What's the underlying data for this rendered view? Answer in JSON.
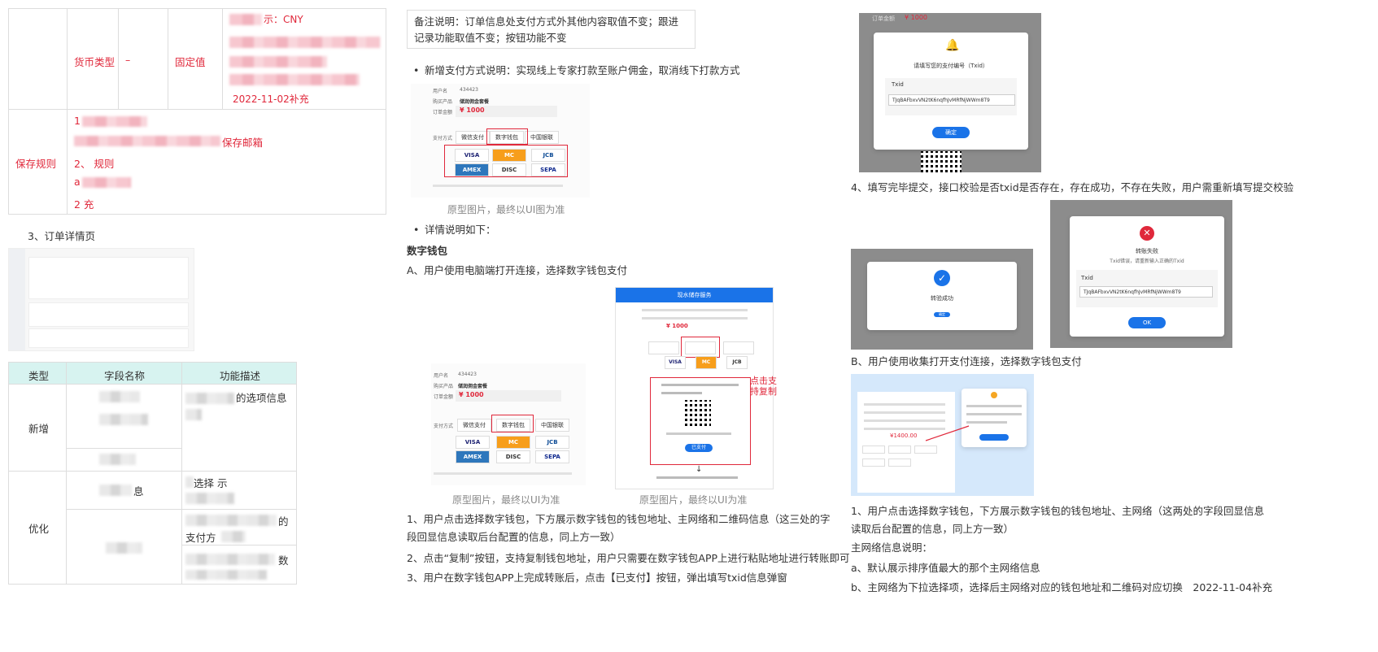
{
  "left": {
    "table1": {
      "row1": {
        "name": "货币类型",
        "dash": "–",
        "type": "固定值",
        "line1": "示：CNY",
        "date": "2022-11-02补充"
      },
      "row2": {
        "name": "保存规则",
        "line1": "1",
        "line2": "保存邮箱",
        "line3": "2、 规则",
        "line4": "a",
        "line5": "2 充"
      }
    },
    "section3": "3、订单详情页",
    "table2": {
      "headers": [
        "类型",
        "字段名称",
        "功能描述"
      ],
      "group1": "新增",
      "group1_desc": "的选项信息",
      "group2": "优化",
      "g2_r1_field": "息",
      "g2_r1_desc": "选择 示",
      "g2_r2_desc1": "的",
      "g2_r2_desc2": "支付方",
      "g2_r3_desc": "数"
    }
  },
  "middle": {
    "note": "备注说明：订单信息处支付方式外其他内容取值不变；跟进记录功能取值不变；按钮功能不变",
    "bullet1": "新增支付方式说明：实现线上专家打款至账户佣金，取消线下打款方式",
    "mock1": {
      "user_label": "用户名",
      "user": "434423",
      "product_label": "购买产品",
      "product": "储润佣金套餐",
      "amount_label": "订单金额",
      "amount": "¥ 1000",
      "pay_label": "支付方式",
      "opt1": "微信支付",
      "opt2": "数字钱包",
      "opt3": "中国银联"
    },
    "caption1": "原型图片，最终以UI图为准",
    "bullet2": "详情说明如下：",
    "heading": "数字钱包",
    "subA": "A、用户使用电脑端打开连接，选择数字钱包支付",
    "mock2": {
      "user_label": "用户名",
      "user": "434423",
      "product_label": "购买产品",
      "product": "储润佣金套餐",
      "amount_label": "订单金额",
      "amount": "¥ 1000",
      "pay_label": "支付方式",
      "opt1": "微信支付",
      "opt2": "数字钱包",
      "opt3": "中国银联"
    },
    "mock3": {
      "header": "现水储存服务",
      "amount": "¥ 1000",
      "pay_btn": "已支付",
      "annot": "点击支持复制"
    },
    "caption2": "原型图片，最终以UI为准",
    "caption3": "原型图片，最终以UI为准",
    "p1": "1、用户点击选择数字钱包，下方展示数字钱包的钱包地址、主网络和二维码信息（这三处的字段回显信息读取后台配置的信息，同上方一致）",
    "p2": "2、点击“复制”按钮，支持复制钱包地址，用户只需要在数字钱包APP上进行粘贴地址进行转账即可",
    "p3": "3、用户在数字钱包APP上完成转账后，点击【已支付】按钮，弹出填写txid信息弹窗"
  },
  "right": {
    "shot1": {
      "amount_label": "订单金额",
      "amount": "¥ 1000",
      "title": "请填写您的支付编号（Txid）",
      "field_label": "Txid",
      "field_value": "TJqBAFbxvVN2tK6nqfhJvMRfNjWWm8T9",
      "btn": "确定"
    },
    "p4": "4、填写完毕提交，接口校验是否txid是否存在，存在成功，不存在失败，用户需重新填写提交校验",
    "shot2": {
      "success": "转验成功",
      "btn": "确定"
    },
    "shot3": {
      "fail": "转账失败",
      "fail_sub": "Txid错误，请重新输入正确的Txid",
      "field_label": "Txid",
      "field_value": "TJqBAFbxvVN2tK6nqfhJvMRfNjWWm8T9",
      "btn": "OK"
    },
    "subB": "B、用户使用收集打开支付连接，选择数字钱包支付",
    "shot4": {
      "amount": "¥1400.00"
    },
    "p5": "1、用户点击选择数字钱包，下方展示数字钱包的钱包地址、主网络（这两处的字段回显信息读取后台配置的信息，同上方一致）",
    "red1": "主网络信息说明：",
    "red2": "a、默认展示排序值最大的那个主网络信息",
    "red3": "b、主网络为下拉选择项，选择后主网络对应的钱包地址和二维码对应切换　2022-11-04补充"
  }
}
